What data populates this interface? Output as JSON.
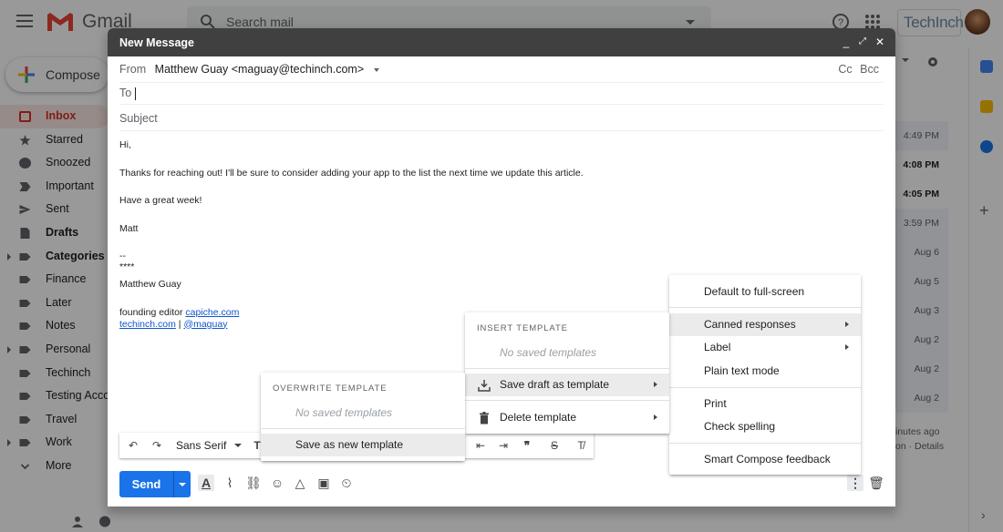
{
  "gmail": {
    "app_name": "Gmail",
    "search_placeholder": "Search mail",
    "brand_text": "TechInch",
    "compose_label": "Compose",
    "nav_items": [
      {
        "label": "Inbox",
        "icon": "inbox-icon",
        "active": true,
        "bold": true
      },
      {
        "label": "Starred",
        "icon": "star-icon"
      },
      {
        "label": "Snoozed",
        "icon": "clock-icon"
      },
      {
        "label": "Important",
        "icon": "important-icon"
      },
      {
        "label": "Sent",
        "icon": "send-icon"
      },
      {
        "label": "Drafts",
        "icon": "draft-icon",
        "bold": true
      },
      {
        "label": "Categories",
        "icon": "label-icon",
        "bold": true,
        "expandable": true
      },
      {
        "label": "Finance",
        "icon": "label-icon"
      },
      {
        "label": "Later",
        "icon": "label-icon"
      },
      {
        "label": "Notes",
        "icon": "label-icon"
      },
      {
        "label": "Personal",
        "icon": "label-icon",
        "expandable": true
      },
      {
        "label": "Techinch",
        "icon": "label-icon"
      },
      {
        "label": "Testing Accounts",
        "icon": "label-icon"
      },
      {
        "label": "Travel",
        "icon": "label-icon"
      },
      {
        "label": "Work",
        "icon": "label-icon",
        "expandable": true
      },
      {
        "label": "More",
        "icon": "chevron-down-icon"
      }
    ],
    "email_times": [
      {
        "time": "4:49 PM",
        "unread": false
      },
      {
        "time": "4:08 PM",
        "unread": true
      },
      {
        "time": "4:05 PM",
        "unread": true
      },
      {
        "time": "3:59 PM",
        "unread": false
      },
      {
        "time": "Aug 6",
        "unread": false
      },
      {
        "time": "Aug 5",
        "unread": false
      },
      {
        "time": "Aug 3",
        "unread": false
      },
      {
        "time": "Aug 2",
        "unread": false
      },
      {
        "time": "Aug 2",
        "unread": false
      },
      {
        "time": "Aug 2",
        "unread": false
      }
    ],
    "activity_line1": "inutes ago",
    "activity_line2": "on · Details"
  },
  "compose": {
    "title": "New Message",
    "from_label": "From",
    "from_value": "Matthew Guay <maguay@techinch.com>",
    "cc_label": "Cc",
    "bcc_label": "Bcc",
    "to_label": "To",
    "subject_label": "Subject",
    "body": {
      "greeting": "Hi,",
      "line1": "Thanks for reaching out! I'll be sure to consider adding your app to the list the next time we update this article.",
      "line2": "Have a great week!",
      "signoff": "Matt",
      "sig_dashes": "--",
      "sig_stars": "****",
      "sig_name": "Matthew Guay",
      "sig_role": "founding editor",
      "sig_link1": "capiche.com",
      "sig_link2": "techinch.com",
      "sig_sep": " | ",
      "sig_link3": "@maguay"
    },
    "font_name": "Sans Serif",
    "send_label": "Send"
  },
  "menus": {
    "more_options": {
      "items": [
        {
          "label": "Default to full-screen"
        },
        {
          "label": "Canned responses",
          "submenu": true,
          "highlighted": true
        },
        {
          "label": "Label",
          "submenu": true
        },
        {
          "label": "Plain text mode"
        },
        {
          "label": "Print"
        },
        {
          "label": "Check spelling"
        },
        {
          "label": "Smart Compose feedback"
        }
      ]
    },
    "canned": {
      "insert_title": "INSERT TEMPLATE",
      "insert_empty": "No saved templates",
      "save_draft": "Save draft as template",
      "delete": "Delete template"
    },
    "overwrite": {
      "title": "OVERWRITE TEMPLATE",
      "empty": "No saved templates",
      "save_new": "Save as new template"
    }
  },
  "colors": {
    "accent_blue": "#1a73e8",
    "inbox_red": "#d93025",
    "header_dark": "#404040",
    "overlay": "rgba(0,0,0,0.4)"
  }
}
